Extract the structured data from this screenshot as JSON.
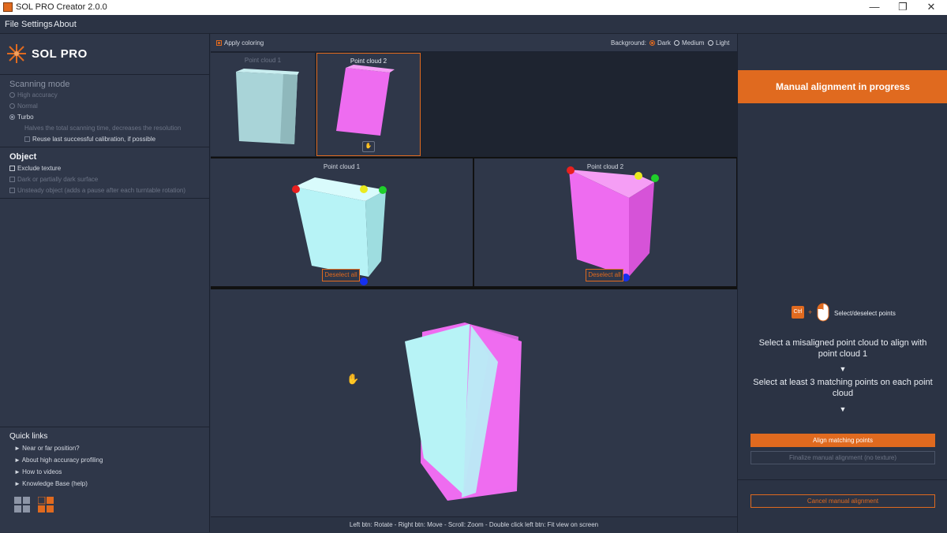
{
  "window": {
    "title": "SOL PRO Creator 2.0.0",
    "minimize": "—",
    "maximize": "❐",
    "close": "✕"
  },
  "menu": {
    "file": "File",
    "settings": "Settings",
    "about": "About"
  },
  "logo": {
    "text": "SOL PRO"
  },
  "scanning": {
    "title": "Scanning mode",
    "high_accuracy": "High accuracy",
    "normal": "Normal",
    "turbo": "Turbo",
    "turbo_desc": "Halves the total scanning time, decreases the resolution",
    "reuse_calibration": "Reuse last successful calibration, if possible"
  },
  "object": {
    "title": "Object",
    "exclude_texture": "Exclude texture",
    "dark_surface": "Dark or partially dark surface",
    "unsteady": "Unsteady object (adds a pause after each turntable rotation)"
  },
  "quick_links": {
    "title": "Quick links",
    "items": [
      "Near or far position?",
      "About high accuracy profiling",
      "How to videos",
      "Knowledge Base (help)"
    ]
  },
  "top_controls": {
    "apply_coloring": "Apply coloring",
    "background_label": "Background:",
    "dark": "Dark",
    "medium": "Medium",
    "light": "Light"
  },
  "thumbnails": {
    "pc1": "Point cloud 1",
    "pc2": "Point cloud 2"
  },
  "views": {
    "pc1": "Point cloud 1",
    "pc2": "Point cloud 2",
    "deselect": "Deselect all"
  },
  "status": {
    "hint": "Left btn: Rotate - Right btn: Move - Scroll: Zoom - Double click left btn: Fit view on screen"
  },
  "right_panel": {
    "banner": "Manual alignment in progress",
    "ctrl_key": "Ctrl",
    "plus": "+",
    "select_hint": "Select/deselect points",
    "instruction_1": "Select a misaligned point cloud to align with point cloud 1",
    "arrow": "▼",
    "instruction_2": "Select at least 3 matching points on each point cloud",
    "align_btn": "Align matching points",
    "finalize_btn": "Finalize manual alignment (no texture)",
    "cancel_btn": "Cancel manual alignment"
  },
  "colors": {
    "accent": "#e06a1f",
    "cyan_cloud": "#b7f3f6",
    "magenta_cloud": "#ee6cf0",
    "panel": "#2f3749"
  }
}
